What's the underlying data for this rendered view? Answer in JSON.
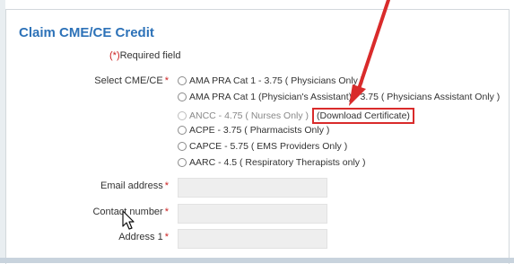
{
  "form": {
    "title": "Claim CME/CE Credit",
    "required_note_star": "(*)",
    "required_note_text": "Required field",
    "select_label": "Select CME/CE",
    "options": [
      {
        "label": "AMA PRA Cat 1 - 3.75 ( Physicians Only )",
        "disabled": false
      },
      {
        "label": "AMA PRA Cat 1 (Physician's Assistant) - 3.75 ( Physicians Assistant Only )",
        "disabled": false
      },
      {
        "label": "ANCC - 4.75 ( Nurses Only )",
        "disabled": true,
        "link": "Download Certificate"
      },
      {
        "label": "ACPE - 3.75 ( Pharmacists Only )",
        "disabled": false
      },
      {
        "label": "CAPCE - 5.75 ( EMS Providers Only )",
        "disabled": false
      },
      {
        "label": "AARC - 4.5 ( Respiratory Therapists only )",
        "disabled": false
      }
    ],
    "fields": [
      {
        "label": "Email address",
        "value": ""
      },
      {
        "label": "Contact number",
        "value": ""
      },
      {
        "label": "Address 1",
        "value": ""
      }
    ],
    "required_star": "*"
  },
  "colors": {
    "title": "#2d72b8",
    "required": "#cc2222",
    "annotation": "#d92b2b"
  },
  "icons": {
    "arrow": "red-arrow-annotation-icon",
    "cursor": "mouse-pointer-icon"
  }
}
